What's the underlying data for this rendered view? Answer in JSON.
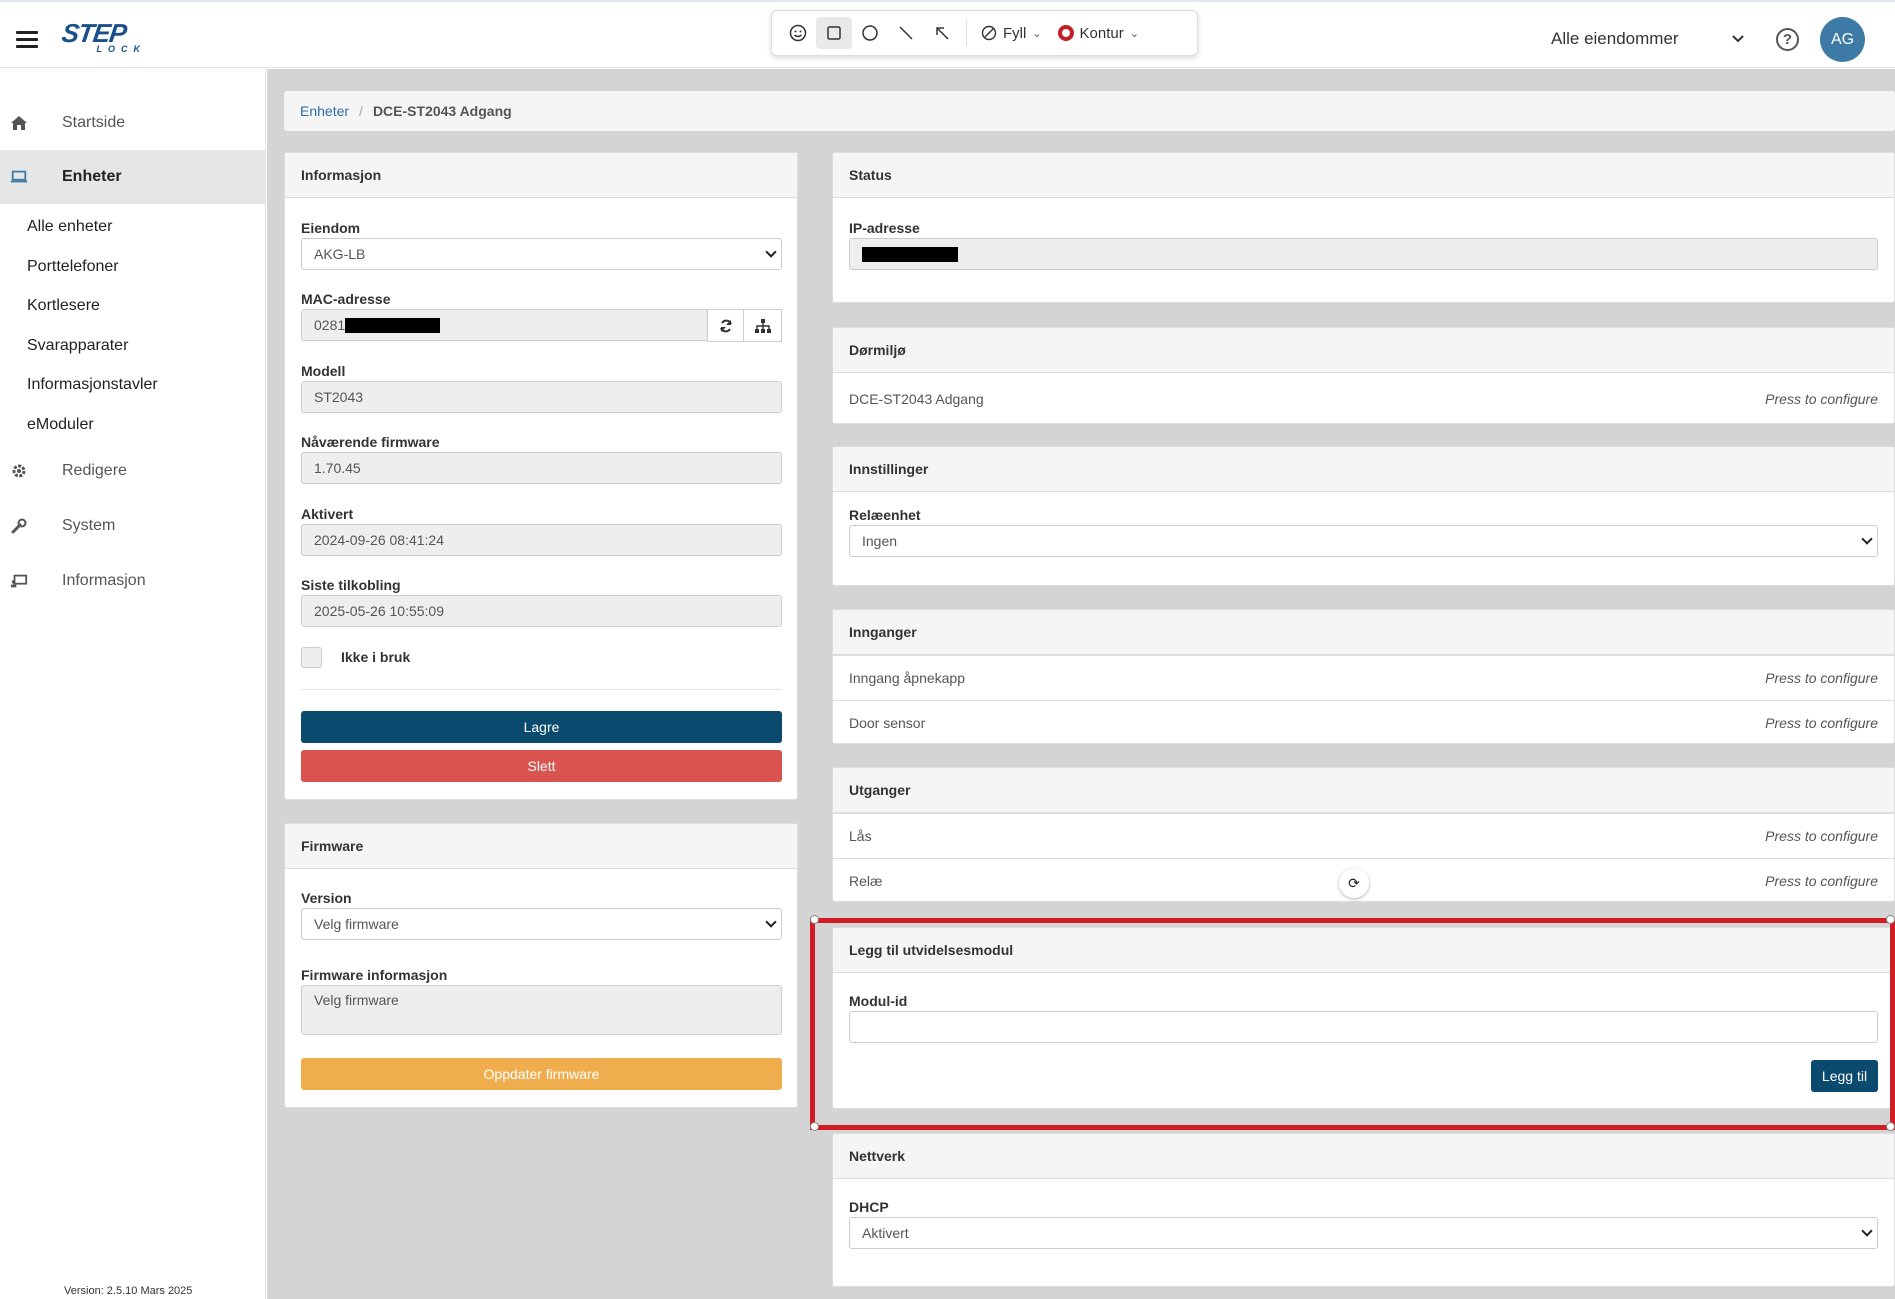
{
  "header": {
    "logo_big": "STEP",
    "logo_small": "LOCK",
    "toolbar": {
      "fill_label": "Fyll",
      "outline_label": "Kontur",
      "outline_color": "#c41f26"
    },
    "property_select": "Alle eiendommer",
    "help_symbol": "?",
    "avatar_initials": "AG"
  },
  "sidebar": {
    "items": [
      {
        "label": "Startside",
        "icon": "home-icon"
      },
      {
        "label": "Enheter",
        "icon": "laptop-icon"
      },
      {
        "label": "Redigere",
        "icon": "gear-icon"
      },
      {
        "label": "System",
        "icon": "wrench-icon"
      },
      {
        "label": "Informasjon",
        "icon": "info-screen-icon"
      }
    ],
    "subitems": [
      "Alle enheter",
      "Porttelefoner",
      "Kortlesere",
      "Svarapparater",
      "Informasjonstavler",
      "eModuler"
    ],
    "version": "Version: 2.5.10 Mars 2025"
  },
  "breadcrumb": {
    "root": "Enheter",
    "current": "DCE-ST2043 Adgang"
  },
  "info_card": {
    "title": "Informasjon",
    "property_label": "Eiendom",
    "property_value": "AKG-LB",
    "mac_label": "MAC-adresse",
    "mac_value": "0281",
    "model_label": "Modell",
    "model_value": "ST2043",
    "firmware_label": "Nåværende firmware",
    "firmware_value": "1.70.45",
    "activated_label": "Aktivert",
    "activated_value": "2024-09-26 08:41:24",
    "lastconn_label": "Siste tilkobling",
    "lastconn_value": "2025-05-26 10:55:09",
    "not_in_use_label": "Ikke i bruk",
    "save_label": "Lagre",
    "delete_label": "Slett"
  },
  "firmware_card": {
    "title": "Firmware",
    "version_label": "Version",
    "version_value": "Velg firmware",
    "info_label": "Firmware informasjon",
    "info_value": "Velg firmware",
    "update_label": "Oppdater firmware"
  },
  "status_card": {
    "title": "Status",
    "ip_label": "IP-adresse"
  },
  "door_card": {
    "title": "Dørmiljø",
    "item": "DCE-ST2043 Adgang",
    "action": "Press to configure"
  },
  "settings_card": {
    "title": "Innstillinger",
    "relay_label": "Relæenhet",
    "relay_value": "Ingen"
  },
  "inputs_card": {
    "title": "Innganger",
    "items": [
      {
        "label": "Inngang åpnekapp",
        "action": "Press to configure"
      },
      {
        "label": "Door sensor",
        "action": "Press to configure"
      }
    ]
  },
  "outputs_card": {
    "title": "Utganger",
    "items": [
      {
        "label": "Lås",
        "action": "Press to configure"
      },
      {
        "label": "Relæ",
        "action": "Press to configure"
      }
    ]
  },
  "module_card": {
    "title": "Legg til utvidelsesmodul",
    "module_label": "Modul-id",
    "module_value": "",
    "add_label": "Legg til"
  },
  "network_card": {
    "title": "Nettverk",
    "dhcp_label": "DHCP",
    "dhcp_value": "Aktivert"
  },
  "colors": {
    "primary": "#0a4a6e",
    "danger": "#d9534f",
    "warning": "#f0ad4e",
    "annotation": "#d01c24",
    "avatar": "#3e7aa6"
  }
}
